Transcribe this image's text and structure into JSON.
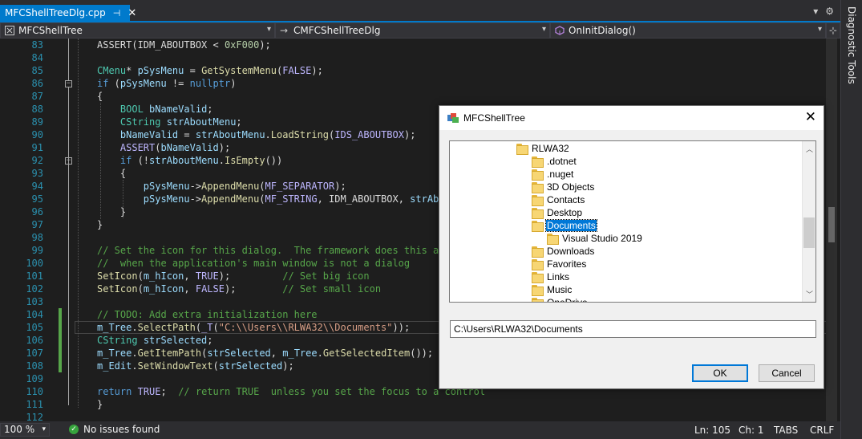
{
  "tab": {
    "title": "MFCShellTreeDlg.cpp",
    "pin": "⊣",
    "close": "✕"
  },
  "tabstrip_right": {
    "dropdown": "▾",
    "gear": "⚙"
  },
  "navbar": {
    "project": "MFCShellTree",
    "class": "CMFCShellTreeDlg",
    "function": "OnInitDialog()"
  },
  "right_panel": {
    "title": "Diagnostic Tools"
  },
  "code_lines": [
    {
      "num": "83",
      "tokens": [
        [
          "",
          "ASSERT(IDM_ABOUTBOX < "
        ],
        [
          "nm",
          "0xF000"
        ],
        [
          "",
          ");"
        ]
      ]
    },
    {
      "num": "84",
      "tokens": []
    },
    {
      "num": "85",
      "tokens": [
        [
          "ty",
          "CMenu"
        ],
        [
          "",
          "* "
        ],
        [
          "va",
          "pSysMenu"
        ],
        [
          "",
          " = "
        ],
        [
          "fn",
          "GetSystemMenu"
        ],
        [
          "",
          "("
        ],
        [
          "mc",
          "FALSE"
        ],
        [
          "",
          ");"
        ]
      ]
    },
    {
      "num": "86",
      "tokens": [
        [
          "kw",
          "if"
        ],
        [
          "",
          " ("
        ],
        [
          "va",
          "pSysMenu"
        ],
        [
          "",
          " != "
        ],
        [
          "kw",
          "nullptr"
        ],
        [
          "",
          ")"
        ]
      ]
    },
    {
      "num": "87",
      "tokens": [
        [
          "",
          "{"
        ]
      ]
    },
    {
      "num": "88",
      "tokens": [
        [
          "",
          "    "
        ],
        [
          "ty",
          "BOOL"
        ],
        [
          "",
          " "
        ],
        [
          "va",
          "bNameValid"
        ],
        [
          "",
          ";"
        ]
      ]
    },
    {
      "num": "89",
      "tokens": [
        [
          "",
          "    "
        ],
        [
          "ty",
          "CString"
        ],
        [
          "",
          " "
        ],
        [
          "va",
          "strAboutMenu"
        ],
        [
          "",
          ";"
        ]
      ]
    },
    {
      "num": "90",
      "tokens": [
        [
          "",
          "    "
        ],
        [
          "va",
          "bNameValid"
        ],
        [
          "",
          " = "
        ],
        [
          "va",
          "strAboutMenu"
        ],
        [
          "",
          "."
        ],
        [
          "fn",
          "LoadString"
        ],
        [
          "",
          "("
        ],
        [
          "mc",
          "IDS_ABOUTBOX"
        ],
        [
          "",
          ");"
        ]
      ]
    },
    {
      "num": "91",
      "tokens": [
        [
          "",
          "    "
        ],
        [
          "mc",
          "ASSERT"
        ],
        [
          "",
          "("
        ],
        [
          "va",
          "bNameValid"
        ],
        [
          "",
          ");"
        ]
      ]
    },
    {
      "num": "92",
      "tokens": [
        [
          "",
          "    "
        ],
        [
          "kw",
          "if"
        ],
        [
          "",
          " (!"
        ],
        [
          "va",
          "strAboutMenu"
        ],
        [
          "",
          "."
        ],
        [
          "fn",
          "IsEmpty"
        ],
        [
          "",
          "())"
        ]
      ]
    },
    {
      "num": "93",
      "tokens": [
        [
          "",
          "    {"
        ]
      ]
    },
    {
      "num": "94",
      "tokens": [
        [
          "",
          "        "
        ],
        [
          "va",
          "pSysMenu"
        ],
        [
          "",
          "->"
        ],
        [
          "fn",
          "AppendMenu"
        ],
        [
          "",
          "("
        ],
        [
          "mc",
          "MF_SEPARATOR"
        ],
        [
          "",
          ");"
        ]
      ]
    },
    {
      "num": "95",
      "tokens": [
        [
          "",
          "        "
        ],
        [
          "va",
          "pSysMenu"
        ],
        [
          "",
          "->"
        ],
        [
          "fn",
          "AppendMenu"
        ],
        [
          "",
          "("
        ],
        [
          "mc",
          "MF_STRING"
        ],
        [
          "",
          ", IDM_ABOUTBOX, "
        ],
        [
          "va",
          "strAbou"
        ]
      ]
    },
    {
      "num": "96",
      "tokens": [
        [
          "",
          "    }"
        ]
      ]
    },
    {
      "num": "97",
      "tokens": [
        [
          "",
          "}"
        ]
      ]
    },
    {
      "num": "98",
      "tokens": []
    },
    {
      "num": "99",
      "tokens": [
        [
          "cm",
          "// Set the icon for this dialog.  The framework does this aut"
        ]
      ]
    },
    {
      "num": "100",
      "tokens": [
        [
          "cm",
          "//  when the application's main window is not a dialog"
        ]
      ]
    },
    {
      "num": "101",
      "tokens": [
        [
          "fn",
          "SetIcon"
        ],
        [
          "",
          "("
        ],
        [
          "va",
          "m_hIcon"
        ],
        [
          "",
          ", "
        ],
        [
          "mc",
          "TRUE"
        ],
        [
          "",
          ");         "
        ],
        [
          "cm",
          "// Set big icon"
        ]
      ]
    },
    {
      "num": "102",
      "tokens": [
        [
          "fn",
          "SetIcon"
        ],
        [
          "",
          "("
        ],
        [
          "va",
          "m_hIcon"
        ],
        [
          "",
          ", "
        ],
        [
          "mc",
          "FALSE"
        ],
        [
          "",
          ");        "
        ],
        [
          "cm",
          "// Set small icon"
        ]
      ]
    },
    {
      "num": "103",
      "tokens": []
    },
    {
      "num": "104",
      "tokens": [
        [
          "cm",
          "// TODO: Add extra initialization here"
        ]
      ]
    },
    {
      "num": "105",
      "tokens": [
        [
          "va",
          "m_Tree"
        ],
        [
          "",
          "."
        ],
        [
          "fn",
          "SelectPath"
        ],
        [
          "",
          "("
        ],
        [
          "mc",
          "_T"
        ],
        [
          "",
          "("
        ],
        [
          "st",
          "\"C:\\\\Users\\\\RLWA32\\\\Documents\""
        ],
        [
          "",
          "));"
        ]
      ]
    },
    {
      "num": "106",
      "tokens": [
        [
          "ty",
          "CString"
        ],
        [
          "",
          " "
        ],
        [
          "va",
          "strSelected"
        ],
        [
          "",
          ";"
        ]
      ]
    },
    {
      "num": "107",
      "tokens": [
        [
          "va",
          "m_Tree"
        ],
        [
          "",
          "."
        ],
        [
          "fn",
          "GetItemPath"
        ],
        [
          "",
          "("
        ],
        [
          "va",
          "strSelected"
        ],
        [
          "",
          ", "
        ],
        [
          "va",
          "m_Tree"
        ],
        [
          "",
          "."
        ],
        [
          "fn",
          "GetSelectedItem"
        ],
        [
          "",
          "());"
        ]
      ]
    },
    {
      "num": "108",
      "tokens": [
        [
          "va",
          "m_Edit"
        ],
        [
          "",
          "."
        ],
        [
          "fn",
          "SetWindowText"
        ],
        [
          "",
          "("
        ],
        [
          "va",
          "strSelected"
        ],
        [
          "",
          ");"
        ]
      ]
    },
    {
      "num": "109",
      "tokens": []
    },
    {
      "num": "110",
      "tokens": [
        [
          "kw",
          "return"
        ],
        [
          "",
          " "
        ],
        [
          "mc",
          "TRUE"
        ],
        [
          "",
          ";  "
        ],
        [
          "cm",
          "// return TRUE  unless you set the focus to a control"
        ]
      ]
    },
    {
      "num": "111",
      "tokens": [
        [
          "",
          "}"
        ]
      ]
    },
    {
      "num": "112",
      "tokens": []
    }
  ],
  "dialog": {
    "title": "MFCShellTree",
    "close": "✕",
    "tree_items": [
      {
        "label": "RLWA32",
        "level": 0,
        "selected": false
      },
      {
        "label": ".dotnet",
        "level": 1,
        "selected": false
      },
      {
        "label": ".nuget",
        "level": 1,
        "selected": false
      },
      {
        "label": "3D Objects",
        "level": 1,
        "selected": false
      },
      {
        "label": "Contacts",
        "level": 1,
        "selected": false
      },
      {
        "label": "Desktop",
        "level": 1,
        "selected": false
      },
      {
        "label": "Documents",
        "level": 1,
        "selected": true
      },
      {
        "label": "Visual Studio 2019",
        "level": 2,
        "selected": false
      },
      {
        "label": "Downloads",
        "level": 1,
        "selected": false
      },
      {
        "label": "Favorites",
        "level": 1,
        "selected": false
      },
      {
        "label": "Links",
        "level": 1,
        "selected": false
      },
      {
        "label": "Music",
        "level": 1,
        "selected": false
      },
      {
        "label": "OneDrive",
        "level": 1,
        "selected": false
      }
    ],
    "path_value": "C:\\Users\\RLWA32\\Documents",
    "ok_label": "OK",
    "cancel_label": "Cancel"
  },
  "statusbar": {
    "zoom": "100 %",
    "issues": "No issues found",
    "ln": "Ln: 105",
    "ch": "Ch: 1",
    "tabs": "TABS",
    "eol": "CRLF"
  },
  "colors": {
    "accent": "#007acc",
    "editor_bg": "#1e1e1e",
    "selection": "#0078d7"
  }
}
